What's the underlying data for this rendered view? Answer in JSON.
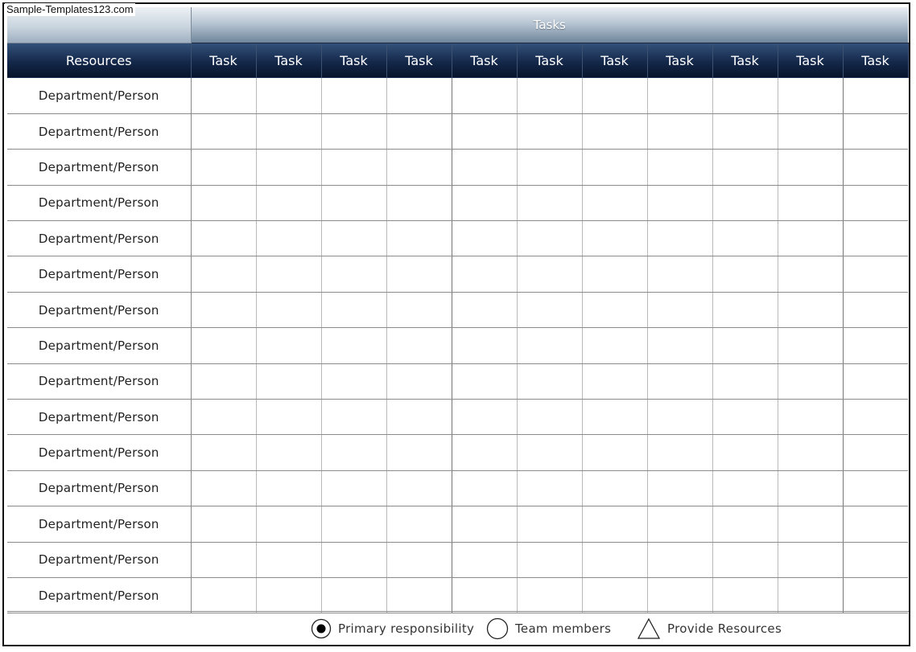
{
  "watermark": "Sample-Templates123.com",
  "header": {
    "tasks_title": "Tasks",
    "resources_label": "Resources",
    "task_columns": [
      "Task",
      "Task",
      "Task",
      "Task",
      "Task",
      "Task",
      "Task",
      "Task",
      "Task",
      "Task",
      "Task"
    ]
  },
  "rows": [
    "Department/Person",
    "Department/Person",
    "Department/Person",
    "Department/Person",
    "Department/Person",
    "Department/Person",
    "Department/Person",
    "Department/Person",
    "Department/Person",
    "Department/Person",
    "Department/Person",
    "Department/Person",
    "Department/Person",
    "Department/Person",
    "Department/Person"
  ],
  "legend": {
    "primary": "Primary responsibility",
    "team": "Team members",
    "resources": "Provide Resources"
  },
  "colors": {
    "header_dark": "#0b1a36",
    "header_light": "#9fb0c1",
    "grid_line": "#8a8a8a"
  }
}
